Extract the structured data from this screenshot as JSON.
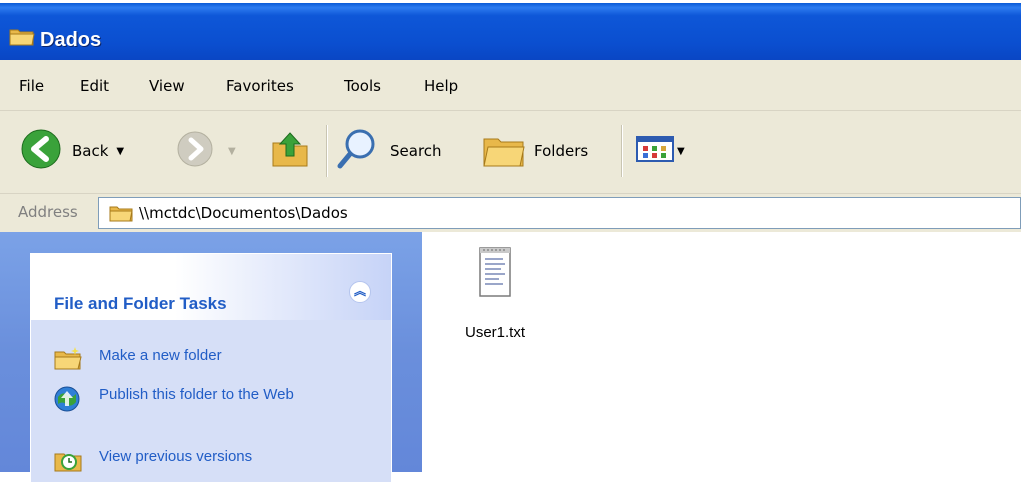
{
  "window": {
    "title": "Dados"
  },
  "menu": [
    {
      "label": "File"
    },
    {
      "label": "Edit"
    },
    {
      "label": "View"
    },
    {
      "label": "Favorites"
    },
    {
      "label": "Tools"
    },
    {
      "label": "Help"
    }
  ],
  "toolbar": {
    "back_label": "Back",
    "search_label": "Search",
    "folders_label": "Folders"
  },
  "address": {
    "label": "Address",
    "value": "\\\\mctdc\\Documentos\\Dados"
  },
  "tasks": {
    "title": "File and Folder Tasks",
    "items": [
      {
        "label": "Make a new folder",
        "icon": "new-folder-icon"
      },
      {
        "label": "Publish this folder to the Web",
        "icon": "publish-web-icon"
      },
      {
        "label": "View previous versions",
        "icon": "previous-versions-icon"
      }
    ]
  },
  "files": [
    {
      "name": "User1.txt",
      "icon": "text-file-icon"
    }
  ],
  "colors": {
    "titlebar": "#0b4fd0",
    "chrome": "#ece9d8",
    "taskpane": "#6a8fdc",
    "task_link": "#215dc6"
  }
}
